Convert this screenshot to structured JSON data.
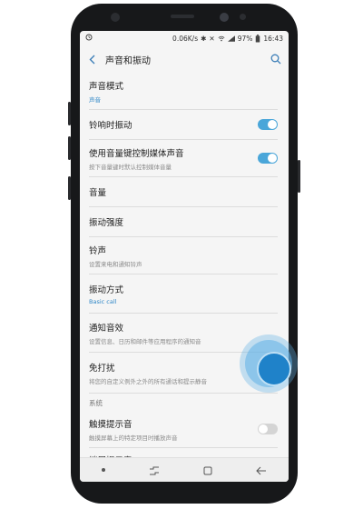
{
  "status": {
    "speed": "0.06K/s",
    "battery": "97%",
    "time": "16:43"
  },
  "appbar": {
    "title": "声音和振动"
  },
  "items": [
    {
      "title": "声音模式",
      "subtitle": "声音",
      "subtitle_blue": true
    },
    {
      "title": "铃响时振动",
      "toggle": "on"
    },
    {
      "title": "使用音量键控制媒体声音",
      "subtitle": "按下音量键时默认控制媒体音量",
      "toggle": "on"
    },
    {
      "title": "音量"
    },
    {
      "title": "振动强度"
    },
    {
      "title": "铃声",
      "subtitle": "设置来电和通知铃声"
    },
    {
      "title": "振动方式",
      "subtitle": "Basic call",
      "subtitle_blue": true
    },
    {
      "title": "通知音效",
      "subtitle": "设置信息、日历和邮件等应用程序的通知音"
    },
    {
      "title": "免打扰",
      "subtitle": "将您的自定义例外之外的所有通话和提示静音",
      "toggle": "on"
    }
  ],
  "section_system": "系统",
  "items_system": [
    {
      "title": "触摸提示音",
      "subtitle": "触摸屏幕上的特定项目时播放声音",
      "toggle": "off"
    },
    {
      "title": "锁屏提示音"
    }
  ],
  "colors": {
    "accent": "#4aa6d9",
    "touch": "#1f82c9"
  },
  "icons": {
    "back": "chevron-left-icon",
    "search": "search-icon"
  }
}
